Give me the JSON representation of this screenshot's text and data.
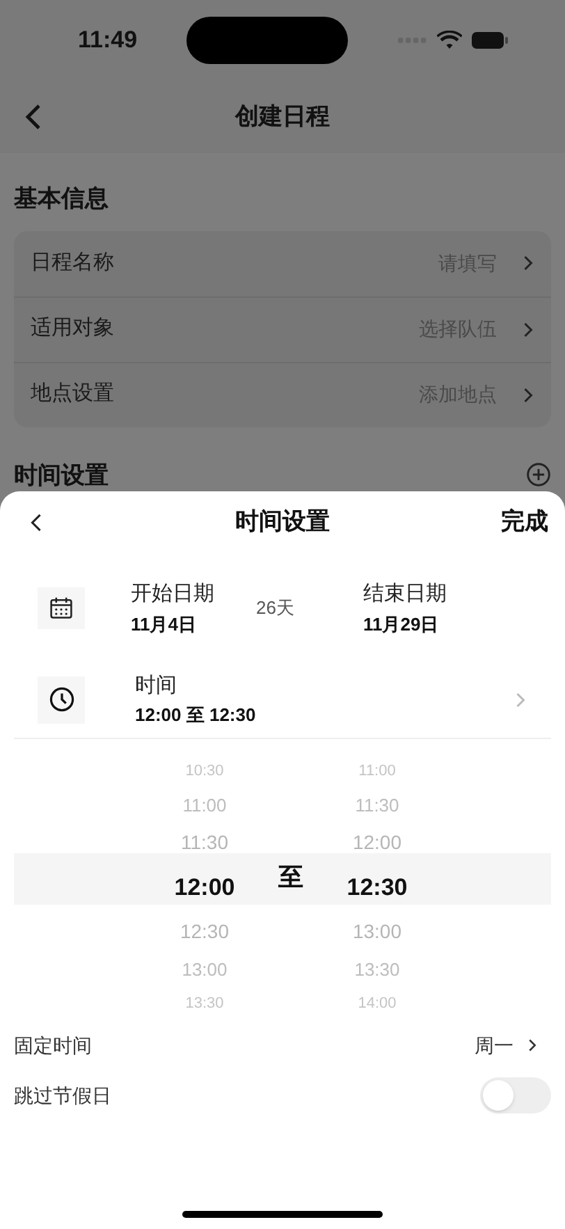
{
  "status_bar": {
    "time": "11:49"
  },
  "header": {
    "title": "创建日程"
  },
  "basic_section": {
    "title": "基本信息",
    "rows": [
      {
        "label": "日程名称",
        "placeholder": "请填写"
      },
      {
        "label": "适用对象",
        "placeholder": "选择队伍"
      },
      {
        "label": "地点设置",
        "placeholder": "添加地点"
      }
    ]
  },
  "time_section": {
    "title": "时间设置"
  },
  "sheet": {
    "title": "时间设置",
    "done": "完成",
    "dates": {
      "start_label": "开始日期",
      "start": "11月4日",
      "duration": "26天",
      "end_label": "结束日期",
      "end": "11月29日"
    },
    "time": {
      "label": "时间",
      "value": "12:00 至 12:30"
    },
    "picker": {
      "separator": "至",
      "start": [
        {
          "label": "10:30",
          "selected": false
        },
        {
          "label": "11:00",
          "selected": false
        },
        {
          "label": "11:30",
          "selected": false
        },
        {
          "label": "12:00",
          "selected": true
        },
        {
          "label": "12:30",
          "selected": false
        },
        {
          "label": "13:00",
          "selected": false
        },
        {
          "label": "13:30",
          "selected": false
        }
      ],
      "end": [
        {
          "label": "11:00",
          "selected": false
        },
        {
          "label": "11:30",
          "selected": false
        },
        {
          "label": "12:00",
          "selected": false
        },
        {
          "label": "12:30",
          "selected": true
        },
        {
          "label": "13:00",
          "selected": false
        },
        {
          "label": "13:30",
          "selected": false
        },
        {
          "label": "14:00",
          "selected": false
        }
      ]
    },
    "settings": [
      {
        "kind": "link",
        "label": "固定时间",
        "value": "周一"
      },
      {
        "kind": "toggle",
        "label": "跳过节假日",
        "on": false
      }
    ]
  }
}
